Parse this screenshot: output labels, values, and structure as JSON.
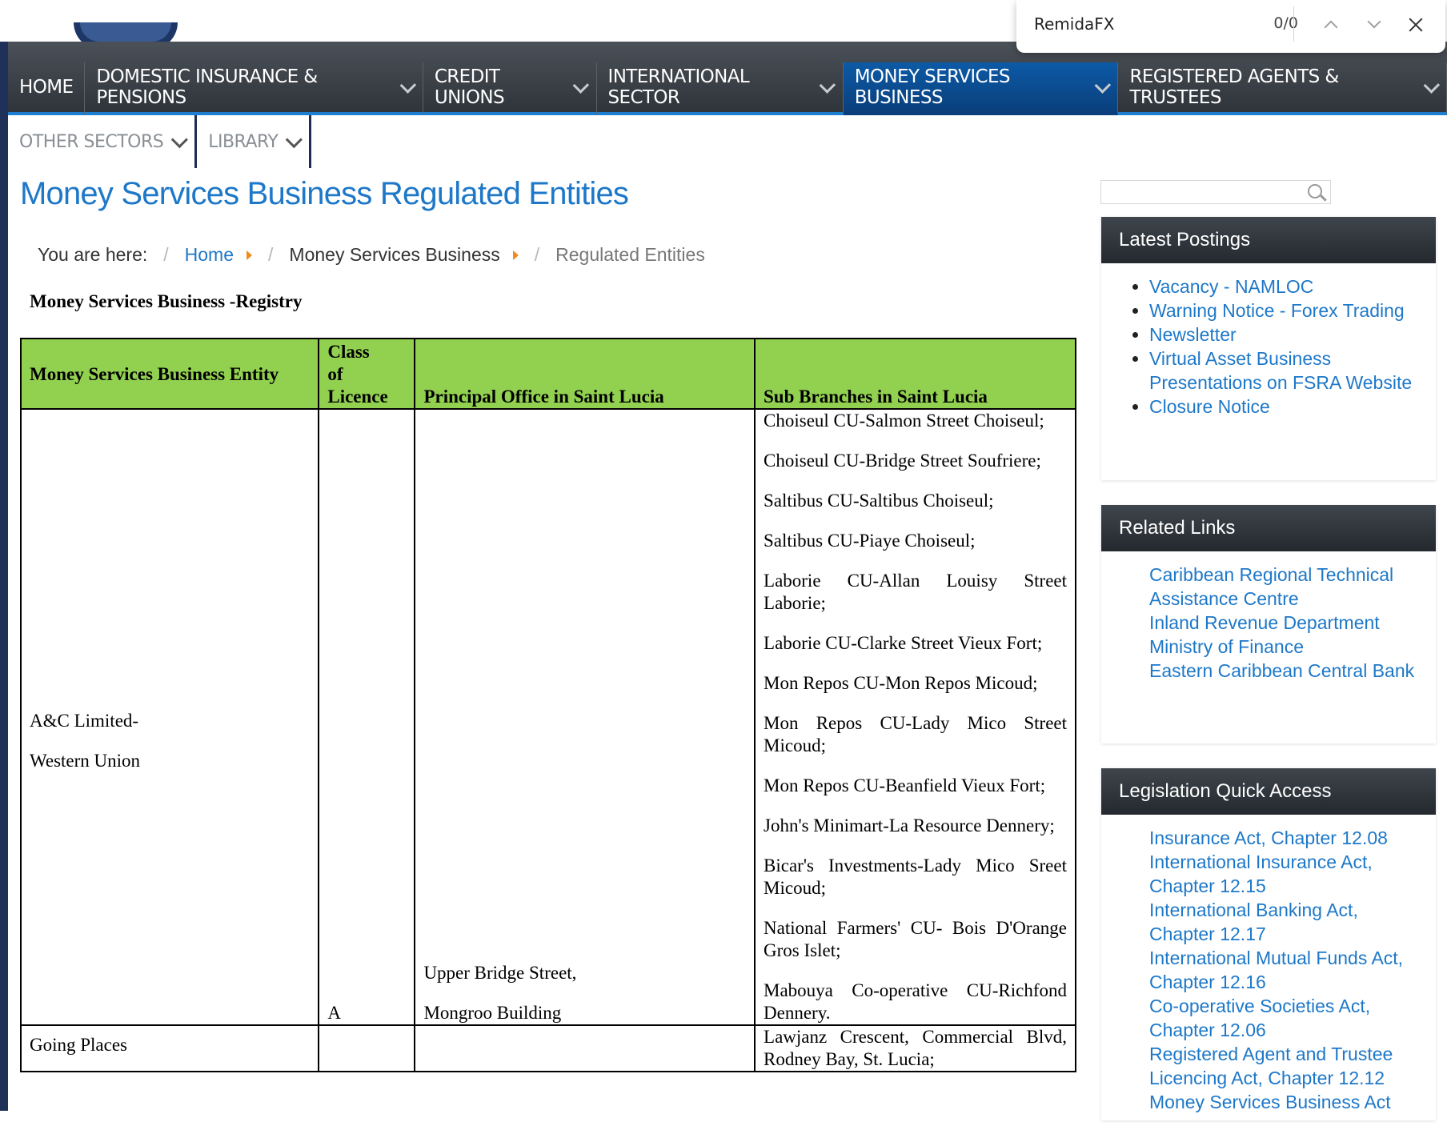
{
  "find_bar": {
    "query": "RemidaFX",
    "count": "0/0"
  },
  "nav": {
    "row1": [
      {
        "label": "HOME",
        "dropdown": false,
        "active": false
      },
      {
        "label": "DOMESTIC INSURANCE & PENSIONS",
        "dropdown": true,
        "active": false
      },
      {
        "label": "CREDIT UNIONS",
        "dropdown": true,
        "active": false
      },
      {
        "label": "INTERNATIONAL SECTOR",
        "dropdown": true,
        "active": false
      },
      {
        "label": "MONEY SERVICES BUSINESS",
        "dropdown": true,
        "active": true
      },
      {
        "label": "REGISTERED AGENTS & TRUSTEES",
        "dropdown": true,
        "active": false
      }
    ],
    "row2": [
      {
        "label": "OTHER SECTORS",
        "dropdown": true
      },
      {
        "label": "LIBRARY",
        "dropdown": true
      }
    ]
  },
  "page_title": "Money Services Business Regulated Entities",
  "breadcrumb": {
    "prefix": "You are here:",
    "items": [
      "Home",
      "Money Services Business",
      "Regulated Entities"
    ]
  },
  "registry_heading": "Money Services Business -Registry",
  "table": {
    "headers": [
      "Money Services Business Entity",
      "Class of Licence",
      "Principal Office in Saint Lucia",
      "Sub Branches in Saint Lucia"
    ],
    "rows": [
      {
        "entity": [
          "A&C Limited-",
          "Western Union"
        ],
        "class": "A",
        "office": [
          "Upper Bridge Street,",
          "Mongroo Building"
        ],
        "branches": [
          "Choiseul CU-Salmon Street Choiseul;",
          "Choiseul CU-Bridge Street Soufriere;",
          "Saltibus CU-Saltibus Choiseul;",
          "Saltibus CU-Piaye Choiseul;",
          "Laborie CU-Allan Louisy Street Laborie;",
          "Laborie CU-Clarke Street Vieux Fort;",
          "Mon Repos CU-Mon Repos Micoud;",
          "Mon Repos CU-Lady Mico Street Micoud;",
          "Mon Repos CU-Beanfield Vieux Fort;",
          "John's Minimart-La Resource Dennery;",
          "Bicar's Investments-Lady Mico Sreet Micoud;",
          "National Farmers' CU- Bois D'Orange Gros Islet;",
          "Mabouya Co-operative CU-Richfond Dennery."
        ]
      },
      {
        "entity": [
          "Going Places"
        ],
        "class": "",
        "office": [],
        "branches": [
          "Lawjanz Crescent, Commercial Blvd, Rodney Bay, St. Lucia;"
        ]
      }
    ]
  },
  "sidebar": {
    "search_placeholder": "",
    "latest_postings": {
      "title": "Latest Postings",
      "items": [
        "Vacancy - NAMLOC",
        "Warning Notice - Forex Trading",
        "Newsletter",
        "Virtual Asset Business Presentations on FSRA Website",
        "Closure Notice"
      ]
    },
    "related_links": {
      "title": "Related Links",
      "items": [
        "Caribbean Regional Technical Assistance Centre",
        "Inland Revenue Department",
        "Ministry of Finance",
        "Eastern Caribbean Central Bank"
      ]
    },
    "legislation": {
      "title": "Legislation Quick Access",
      "items": [
        "Insurance Act, Chapter 12.08",
        "International Insurance Act, Chapter 12.15",
        "International Banking Act, Chapter 12.17",
        "International Mutual Funds Act, Chapter 12.16",
        "Co-operative Societies Act, Chapter 12.06",
        "Registered Agent and Trustee Licencing Act, Chapter 12.12",
        "Money Services Business Act"
      ]
    }
  },
  "colors": {
    "accent": "#1e78c8",
    "nav_active": "#0d5aa6",
    "table_header": "#92d050",
    "breadcrumb_arrow": "#f08a1e"
  }
}
